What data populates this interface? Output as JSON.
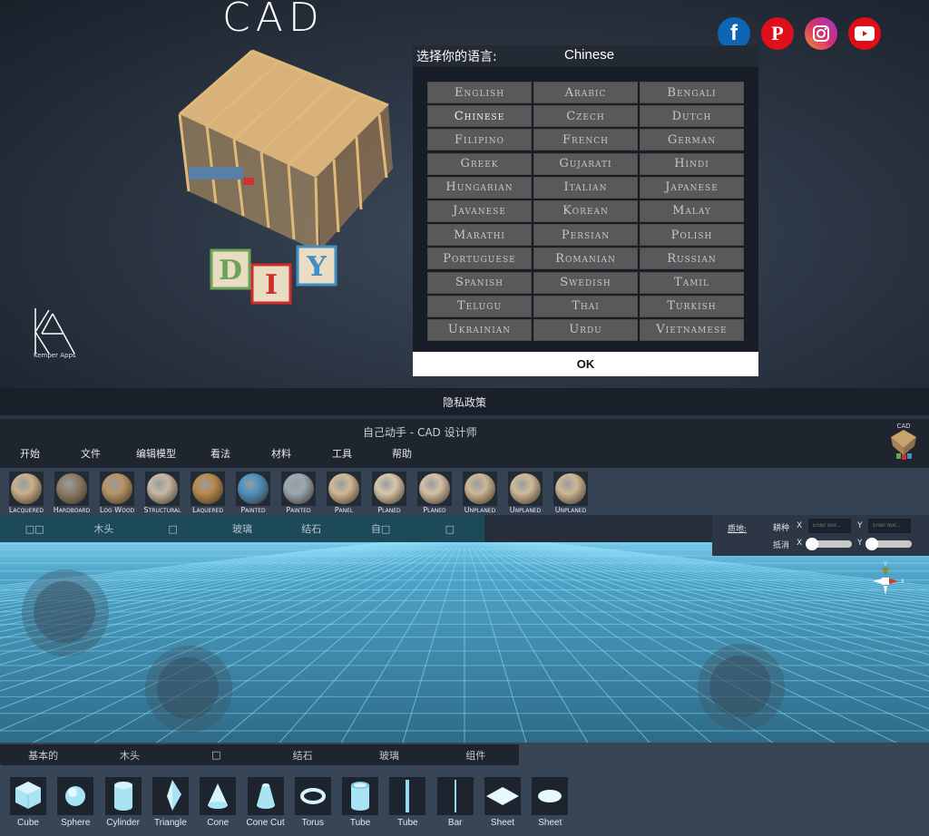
{
  "splash": {
    "title": "CAD",
    "brand": "Kemper Apps",
    "social": [
      {
        "name": "facebook",
        "glyph": "f",
        "color": "#0e65b4"
      },
      {
        "name": "pinterest",
        "glyph": "P",
        "color": "#e10e1b"
      },
      {
        "name": "instagram",
        "glyph": "",
        "color": "#d6306d"
      },
      {
        "name": "youtube",
        "glyph": "",
        "color": "#e00d16"
      }
    ],
    "privacy": "隐私政策"
  },
  "dialog": {
    "prompt": "选择你的语言:",
    "current": "Chinese",
    "ok": "OK",
    "languages": [
      "English",
      "Arabic",
      "Bengali",
      "Chinese",
      "Czech",
      "Dutch",
      "Filipino",
      "French",
      "German",
      "Greek",
      "Gujarati",
      "Hindi",
      "Hungarian",
      "Italian",
      "Japanese",
      "Javanese",
      "Korean",
      "Malay",
      "Marathi",
      "Persian",
      "Polish",
      "Portuguese",
      "Romanian",
      "Russian",
      "Spanish",
      "Swedish",
      "Tamil",
      "Telugu",
      "Thai",
      "Turkish",
      "Ukrainian",
      "Urdu",
      "Vietnamese"
    ],
    "selected": "Chinese"
  },
  "app": {
    "title": "自己动手 - CAD 设计师",
    "menu": [
      "开始",
      "文件",
      "编辑模型",
      "看法",
      "材料",
      "工具",
      "帮助"
    ],
    "materials": [
      {
        "label": "Lacquered",
        "color": "#c9b08a"
      },
      {
        "label": "Hardboard",
        "color": "#8e7d68"
      },
      {
        "label": "Log Wood",
        "color": "#b89467"
      },
      {
        "label": "Structural",
        "color": "#c7b9a4"
      },
      {
        "label": "Laquered",
        "color": "#b98a4e"
      },
      {
        "label": "Painted",
        "color": "#4d92c0"
      },
      {
        "label": "Painted",
        "color": "#9aa8b3"
      },
      {
        "label": "Panel",
        "color": "#d0b995"
      },
      {
        "label": "Planed",
        "color": "#d8c7ab"
      },
      {
        "label": "Planed",
        "color": "#d4c1a3"
      },
      {
        "label": "Unplaned",
        "color": "#cdb795"
      },
      {
        "label": "Unplaned",
        "color": "#cfba9a"
      },
      {
        "label": "Unplaned",
        "color": "#cdb896"
      }
    ],
    "material_tabs": [
      "□□",
      "木头",
      "□",
      "玻璃",
      "结石",
      "自□",
      "□"
    ],
    "props": {
      "surface_label": "质地:",
      "tiling_label": "耕种",
      "offset_label": "抵消",
      "x": "X",
      "y": "Y",
      "tiling_x_placeholder": "Enter text...",
      "tiling_y_placeholder": "Enter text...",
      "offset_x": 0,
      "offset_y": 0
    },
    "gizmo": {
      "y": "Y",
      "x": "X"
    },
    "shape_tabs": [
      "基本的",
      "木头",
      "□",
      "结石",
      "玻璃",
      "组件"
    ],
    "shapes": [
      {
        "label": "Cube",
        "icon": "cube"
      },
      {
        "label": "Sphere",
        "icon": "sphere"
      },
      {
        "label": "Cylinder",
        "icon": "cylinder"
      },
      {
        "label": "Triangle",
        "icon": "triangle"
      },
      {
        "label": "Cone",
        "icon": "cone"
      },
      {
        "label": "Cone Cut",
        "icon": "cone-cut"
      },
      {
        "label": "Torus",
        "icon": "torus"
      },
      {
        "label": "Tube",
        "icon": "tube"
      },
      {
        "label": "Tube",
        "icon": "thin-tube"
      },
      {
        "label": "Bar",
        "icon": "bar"
      },
      {
        "label": "Sheet",
        "icon": "sheet"
      },
      {
        "label": "Sheet",
        "icon": "round-sheet"
      }
    ]
  }
}
